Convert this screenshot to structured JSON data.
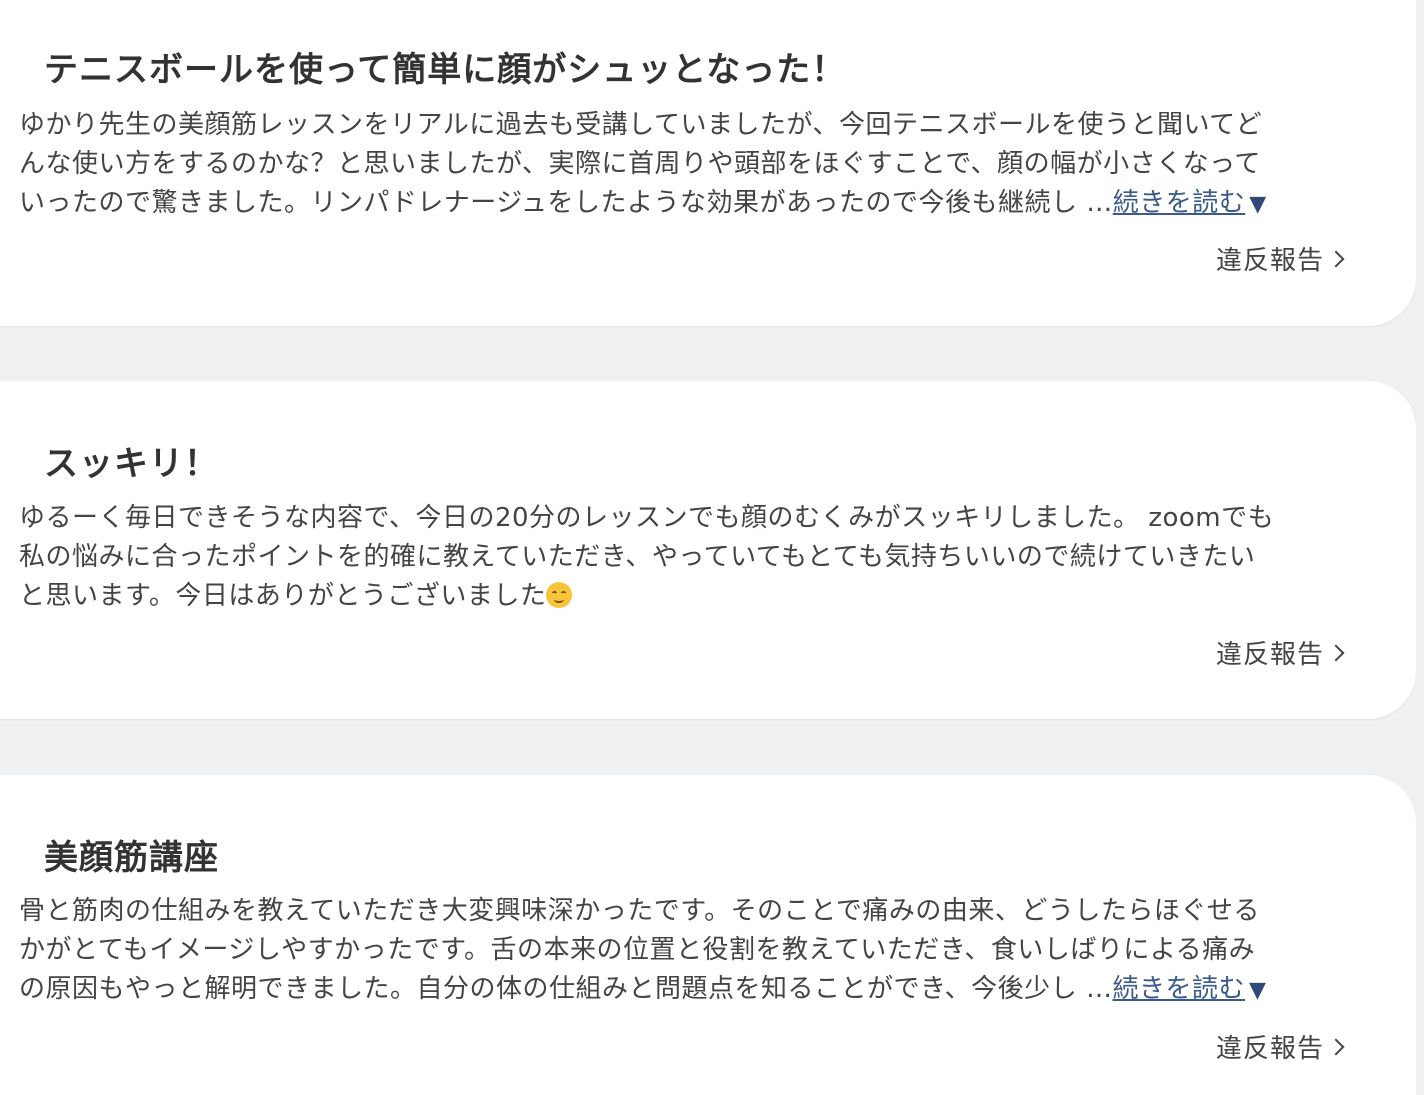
{
  "reviews": [
    {
      "title": "テニスボールを使って簡単に顔がシュッとなった！",
      "lines": [
        "ゆかり先生の美顔筋レッスンをリアルに過去も受講していましたが、今回テニスボールを使うと聞いてど",
        "んな使い方をするのかな？と思いましたが、実際に首周りや頭部をほぐすことで、顔の幅が小さくなって",
        "いったので驚きました。リンパドレナージュをしたような効果があったので今後も継続し …"
      ],
      "read_more": "続きを読む",
      "read_more_caret": "▼",
      "report": "違反報告"
    },
    {
      "title": "スッキリ！",
      "lines": [
        "ゆるーく毎日できそうな内容で、今日の20分のレッスンでも顔のむくみがスッキリしました。 zoomでも",
        "私の悩みに合ったポイントを的確に教えていただき、やっていてもとても気持ちいいので続けていきたい",
        "と思います。今日はありがとうございました"
      ],
      "emoji": "smiling-face-icon",
      "report": "違反報告"
    },
    {
      "title": "美顔筋講座",
      "lines": [
        "骨と筋肉の仕組みを教えていただき大変興味深かったです。そのことで痛みの由来、どうしたらほぐせる",
        "かがとてもイメージしやすかったです。舌の本来の位置と役割を教えていただき、食いしばりによる痛み",
        "の原因もやっと解明できました。自分の体の仕組みと問題点を知ることができ、今後少し …"
      ],
      "read_more": "続きを読む",
      "read_more_caret": "▼",
      "report": "違反報告"
    }
  ],
  "colors": {
    "background": "#eef0f2",
    "card": "#ffffff",
    "text": "#333333",
    "link": "#3a5a8c"
  }
}
